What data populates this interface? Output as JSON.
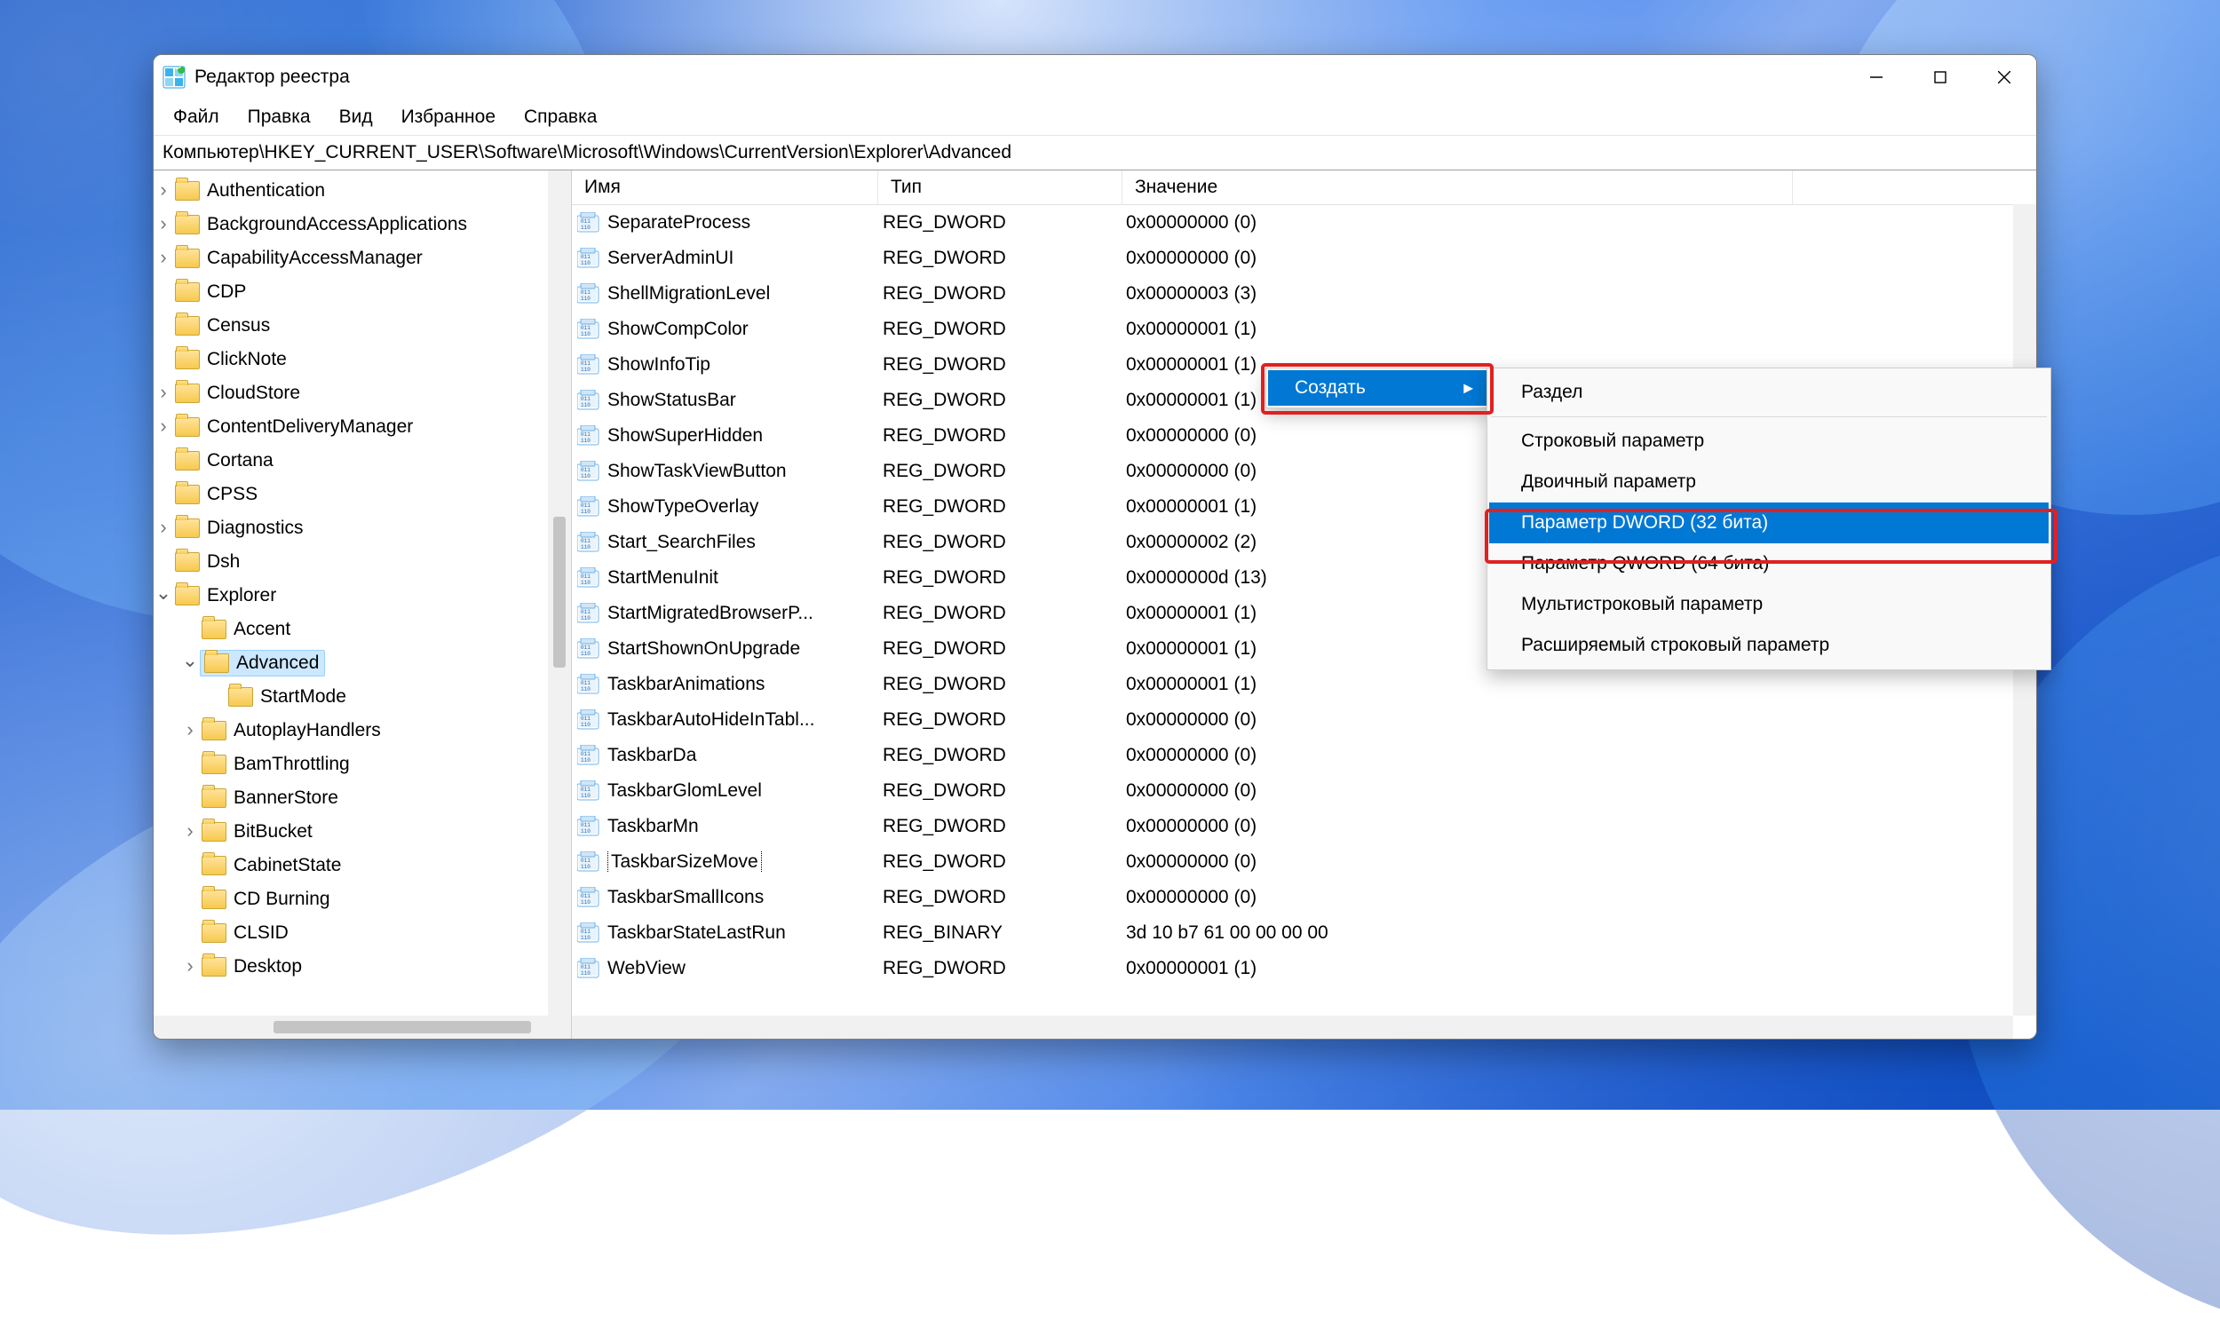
{
  "titlebar": {
    "title": "Редактор реестра"
  },
  "menubar": {
    "items": [
      "Файл",
      "Правка",
      "Вид",
      "Избранное",
      "Справка"
    ]
  },
  "addressbar": {
    "path": "Компьютер\\HKEY_CURRENT_USER\\Software\\Microsoft\\Windows\\CurrentVersion\\Explorer\\Advanced"
  },
  "tree": {
    "items": [
      {
        "level": 0,
        "expander": "closed",
        "label": "Authentication"
      },
      {
        "level": 0,
        "expander": "closed",
        "label": "BackgroundAccessApplications"
      },
      {
        "level": 0,
        "expander": "closed",
        "label": "CapabilityAccessManager"
      },
      {
        "level": 0,
        "expander": "none",
        "label": "CDP"
      },
      {
        "level": 0,
        "expander": "none",
        "label": "Census"
      },
      {
        "level": 0,
        "expander": "none",
        "label": "ClickNote"
      },
      {
        "level": 0,
        "expander": "closed",
        "label": "CloudStore"
      },
      {
        "level": 0,
        "expander": "closed",
        "label": "ContentDeliveryManager"
      },
      {
        "level": 0,
        "expander": "none",
        "label": "Cortana"
      },
      {
        "level": 0,
        "expander": "none",
        "label": "CPSS"
      },
      {
        "level": 0,
        "expander": "closed",
        "label": "Diagnostics"
      },
      {
        "level": 0,
        "expander": "none",
        "label": "Dsh"
      },
      {
        "level": 0,
        "expander": "open",
        "label": "Explorer"
      },
      {
        "level": 1,
        "expander": "none",
        "label": "Accent"
      },
      {
        "level": 1,
        "expander": "open",
        "label": "Advanced",
        "selected": true
      },
      {
        "level": 2,
        "expander": "none",
        "label": "StartMode"
      },
      {
        "level": 1,
        "expander": "closed",
        "label": "AutoplayHandlers"
      },
      {
        "level": 1,
        "expander": "none",
        "label": "BamThrottling"
      },
      {
        "level": 1,
        "expander": "none",
        "label": "BannerStore"
      },
      {
        "level": 1,
        "expander": "closed",
        "label": "BitBucket"
      },
      {
        "level": 1,
        "expander": "none",
        "label": "CabinetState"
      },
      {
        "level": 1,
        "expander": "none",
        "label": "CD Burning"
      },
      {
        "level": 1,
        "expander": "none",
        "label": "CLSID"
      },
      {
        "level": 1,
        "expander": "closed",
        "label": "Desktop"
      }
    ]
  },
  "list": {
    "headers": {
      "name": "Имя",
      "type": "Тип",
      "value": "Значение"
    },
    "rows": [
      {
        "name": "SeparateProcess",
        "type": "REG_DWORD",
        "value": "0x00000000 (0)",
        "icon": "dword"
      },
      {
        "name": "ServerAdminUI",
        "type": "REG_DWORD",
        "value": "0x00000000 (0)",
        "icon": "dword"
      },
      {
        "name": "ShellMigrationLevel",
        "type": "REG_DWORD",
        "value": "0x00000003 (3)",
        "icon": "dword"
      },
      {
        "name": "ShowCompColor",
        "type": "REG_DWORD",
        "value": "0x00000001 (1)",
        "icon": "dword"
      },
      {
        "name": "ShowInfoTip",
        "type": "REG_DWORD",
        "value": "0x00000001 (1)",
        "icon": "dword"
      },
      {
        "name": "ShowStatusBar",
        "type": "REG_DWORD",
        "value": "0x00000001 (1)",
        "icon": "dword"
      },
      {
        "name": "ShowSuperHidden",
        "type": "REG_DWORD",
        "value": "0x00000000 (0)",
        "icon": "dword"
      },
      {
        "name": "ShowTaskViewButton",
        "type": "REG_DWORD",
        "value": "0x00000000 (0)",
        "icon": "dword"
      },
      {
        "name": "ShowTypeOverlay",
        "type": "REG_DWORD",
        "value": "0x00000001 (1)",
        "icon": "dword"
      },
      {
        "name": "Start_SearchFiles",
        "type": "REG_DWORD",
        "value": "0x00000002 (2)",
        "icon": "dword"
      },
      {
        "name": "StartMenuInit",
        "type": "REG_DWORD",
        "value": "0x0000000d (13)",
        "icon": "dword"
      },
      {
        "name": "StartMigratedBrowserP...",
        "type": "REG_DWORD",
        "value": "0x00000001 (1)",
        "icon": "dword"
      },
      {
        "name": "StartShownOnUpgrade",
        "type": "REG_DWORD",
        "value": "0x00000001 (1)",
        "icon": "dword"
      },
      {
        "name": "TaskbarAnimations",
        "type": "REG_DWORD",
        "value": "0x00000001 (1)",
        "icon": "dword"
      },
      {
        "name": "TaskbarAutoHideInTabl...",
        "type": "REG_DWORD",
        "value": "0x00000000 (0)",
        "icon": "dword"
      },
      {
        "name": "TaskbarDa",
        "type": "REG_DWORD",
        "value": "0x00000000 (0)",
        "icon": "dword"
      },
      {
        "name": "TaskbarGlomLevel",
        "type": "REG_DWORD",
        "value": "0x00000000 (0)",
        "icon": "dword"
      },
      {
        "name": "TaskbarMn",
        "type": "REG_DWORD",
        "value": "0x00000000 (0)",
        "icon": "dword"
      },
      {
        "name": "TaskbarSizeMove",
        "type": "REG_DWORD",
        "value": "0x00000000 (0)",
        "icon": "dword",
        "focusring": true
      },
      {
        "name": "TaskbarSmallIcons",
        "type": "REG_DWORD",
        "value": "0x00000000 (0)",
        "icon": "dword"
      },
      {
        "name": "TaskbarStateLastRun",
        "type": "REG_BINARY",
        "value": "3d 10 b7 61 00 00 00 00",
        "icon": "dword"
      },
      {
        "name": "WebView",
        "type": "REG_DWORD",
        "value": "0x00000001 (1)",
        "icon": "dword"
      }
    ]
  },
  "context_parent": {
    "items": [
      {
        "label": "Создать",
        "selected": true,
        "submenu": true
      }
    ]
  },
  "context_child": {
    "items": [
      {
        "label": "Раздел"
      },
      {
        "sep": true
      },
      {
        "label": "Строковый параметр"
      },
      {
        "label": "Двоичный параметр"
      },
      {
        "label": "Параметр DWORD (32 бита)",
        "selected": true
      },
      {
        "label": "Параметр QWORD (64 бита)"
      },
      {
        "label": "Мультистроковый параметр"
      },
      {
        "label": "Расширяемый строковый параметр"
      }
    ]
  }
}
